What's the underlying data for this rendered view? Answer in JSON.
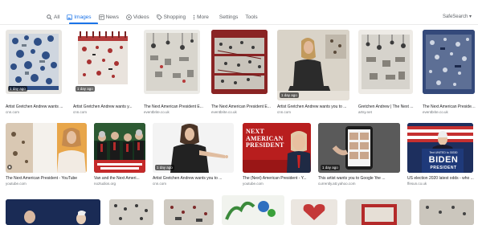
{
  "tabs": [
    {
      "label": "All",
      "icon": "search-icon"
    },
    {
      "label": "Images",
      "icon": "image-icon"
    },
    {
      "label": "News",
      "icon": "news-icon"
    },
    {
      "label": "Videos",
      "icon": "video-icon"
    },
    {
      "label": "Shopping",
      "icon": "tag-icon"
    },
    {
      "label": "More",
      "icon": "more-icon"
    }
  ],
  "tools": {
    "settings": "Settings",
    "tools": "Tools"
  },
  "safesearch": "SafeSearch ▾",
  "row1": [
    {
      "caption": "Artist Gretchen Andrew wants ...",
      "source": "cnn.com",
      "badge": "1 day ago"
    },
    {
      "caption": "Artist Gretchen Andrew wants y...",
      "source": "cnn.com",
      "badge": "1 day ago"
    },
    {
      "caption": "The Next American President E...",
      "source": "eventbrite.co.uk",
      "badge": ""
    },
    {
      "caption": "The Next American President E...",
      "source": "eventbrite.co.uk",
      "badge": ""
    },
    {
      "caption": "Artist Gretchen Andrew wants you to ...",
      "source": "cnn.com",
      "badge": "1 day ago"
    },
    {
      "caption": "Gretchen Andrew | The Next ...",
      "source": "artsy.net",
      "badge": ""
    },
    {
      "caption": "The Next American President E...",
      "source": "eventbrite.co.uk",
      "badge": ""
    }
  ],
  "row2": [
    {
      "caption": "The Next American President - YouTube",
      "source": "youtube.com",
      "badge": ""
    },
    {
      "caption": "Van and the Next Ameri...",
      "source": "noztudios.org",
      "badge": ""
    },
    {
      "caption": "Artist Gretchen Andrew wants you to ...",
      "source": "cnn.com",
      "badge": "1 day ago"
    },
    {
      "caption": "The (Next) American President - Y...",
      "source": "youtube.com",
      "badge": ""
    },
    {
      "caption": "This artist wants you to Google 'the ...",
      "source": "currently.att.yahoo.com",
      "badge": "1 day ago"
    },
    {
      "caption": "US election 2020 latest odds - who ...",
      "source": "ffesun.co.uk",
      "badge": ""
    }
  ],
  "overlays": {
    "next_american_president": "NEXT AMERICAN PRESIDENT",
    "biden_top": "Text UNITED to 30330",
    "biden_name": "BIDEN",
    "biden_sub": "PRESIDENT"
  },
  "colors": {
    "accent": "#1a73e8",
    "text": "#202124",
    "muted": "#70757a"
  }
}
